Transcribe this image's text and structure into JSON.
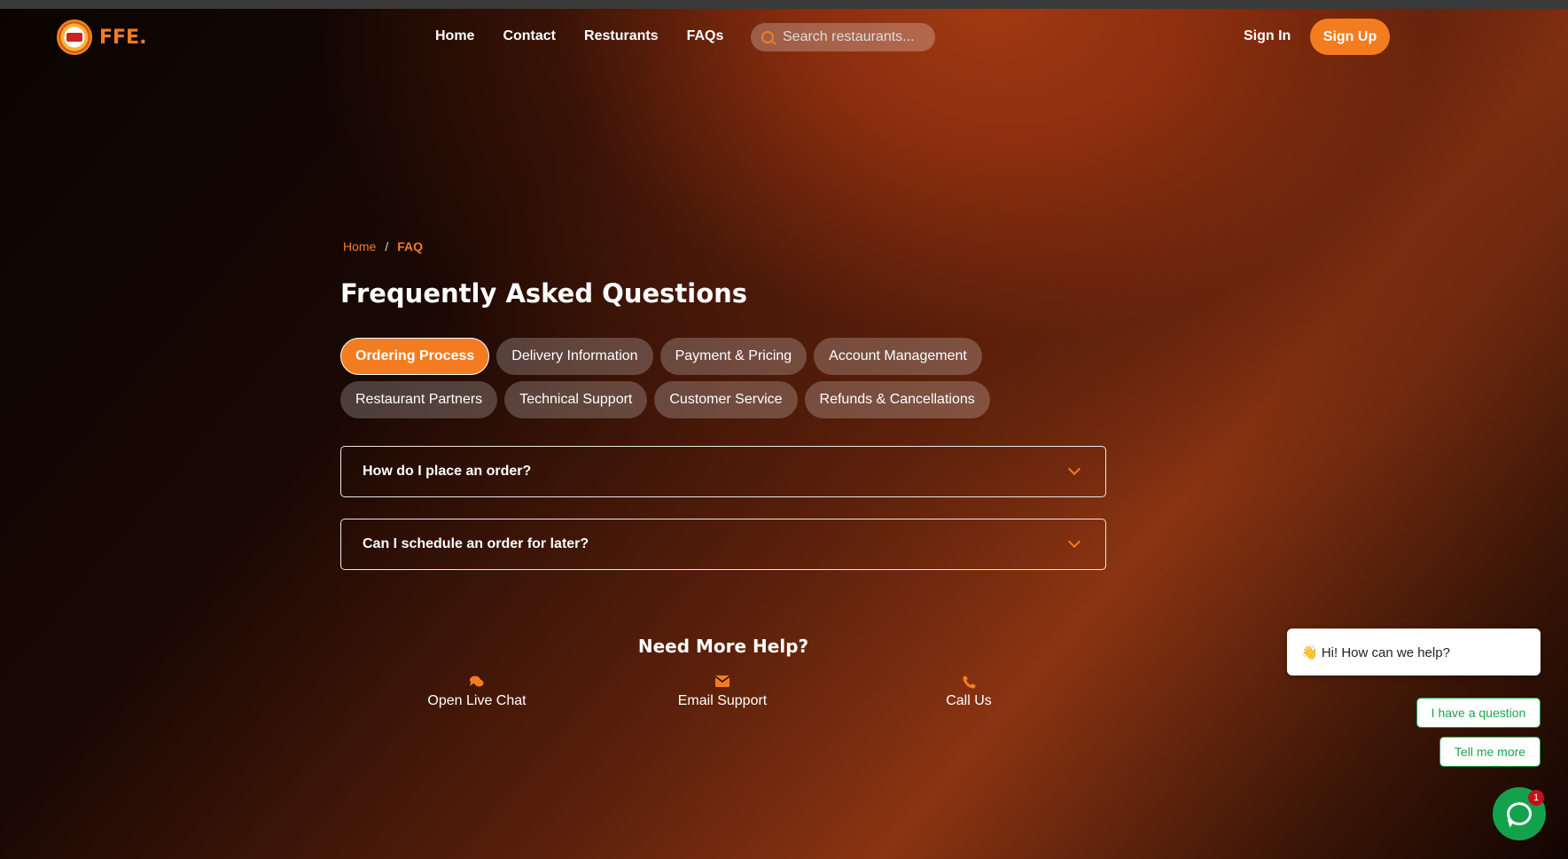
{
  "brand": {
    "name": "FFE."
  },
  "nav": {
    "items": [
      "Home",
      "Contact",
      "Resturants",
      "FAQs"
    ]
  },
  "search": {
    "placeholder": "Search restaurants..."
  },
  "auth": {
    "sign_in": "Sign In",
    "sign_up": "Sign Up"
  },
  "breadcrumb": {
    "home": "Home",
    "separator": "/",
    "current": "FAQ"
  },
  "page": {
    "title": "Frequently Asked Questions"
  },
  "tabs": {
    "items": [
      "Ordering Process",
      "Delivery Information",
      "Payment & Pricing",
      "Account Management",
      "Restaurant Partners",
      "Technical Support",
      "Customer Service",
      "Refunds & Cancellations"
    ],
    "active": "Ordering Process"
  },
  "faqs": [
    {
      "question": "How do I place an order?"
    },
    {
      "question": "Can I schedule an order for later?"
    }
  ],
  "help": {
    "title": "Need More Help?",
    "options": [
      {
        "label": "Open Live Chat",
        "icon": "chat-icon"
      },
      {
        "label": "Email Support",
        "icon": "envelope-icon"
      },
      {
        "label": "Call Us",
        "icon": "phone-icon"
      }
    ]
  },
  "chat_widget": {
    "greeting": "👋 Hi! How can we help?",
    "quick_replies": [
      "I have a question",
      "Tell me more"
    ],
    "unread_count": "1"
  },
  "colors": {
    "accent": "#f47c20",
    "chat_green": "#13a24b"
  }
}
